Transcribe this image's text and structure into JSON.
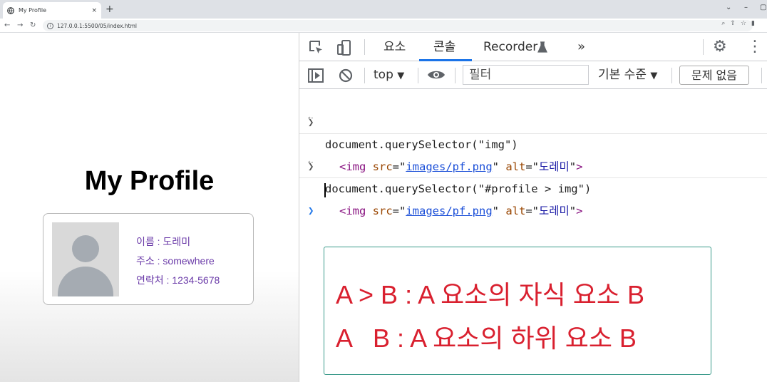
{
  "browser": {
    "tab_title": "My Profile",
    "tab_close": "×",
    "new_tab": "+",
    "url": "127.0.0.1:5500/05/index.html"
  },
  "page": {
    "heading": "My Profile",
    "profile": {
      "name_line": "이름 : 도레미",
      "address_line": "주소 : somewhere",
      "contact_line": "연락처 : 1234-5678"
    }
  },
  "devtools": {
    "tabs": [
      "요소",
      "콘솔",
      "Recorder"
    ],
    "active_tab": "콘솔",
    "more_tabs": "»",
    "toolbar": {
      "context": "top",
      "filter_placeholder": "필터",
      "level": "기본 수준",
      "issues": "문제 없음"
    },
    "console": [
      {
        "input": "document.querySelector(\"img\")",
        "result": {
          "tag_open": "<img",
          "src_attr": "src",
          "src": "images/pf.png",
          "alt_attr": "alt",
          "alt": "도레미",
          "tag_close": ">"
        }
      },
      {
        "input": "document.querySelector(\"#profile > img\")",
        "result": {
          "tag_open": "<img",
          "src_attr": "src",
          "src": "images/pf.png",
          "alt_attr": "alt",
          "alt": "도레미",
          "tag_close": ">"
        }
      }
    ]
  },
  "note": {
    "line1": "A > B : A 요소의 자식 요소 B",
    "line2": "A   B : A 요소의 하위 요소 B",
    "border_color": "#3a9a8a",
    "text_color": "#d9202f"
  }
}
